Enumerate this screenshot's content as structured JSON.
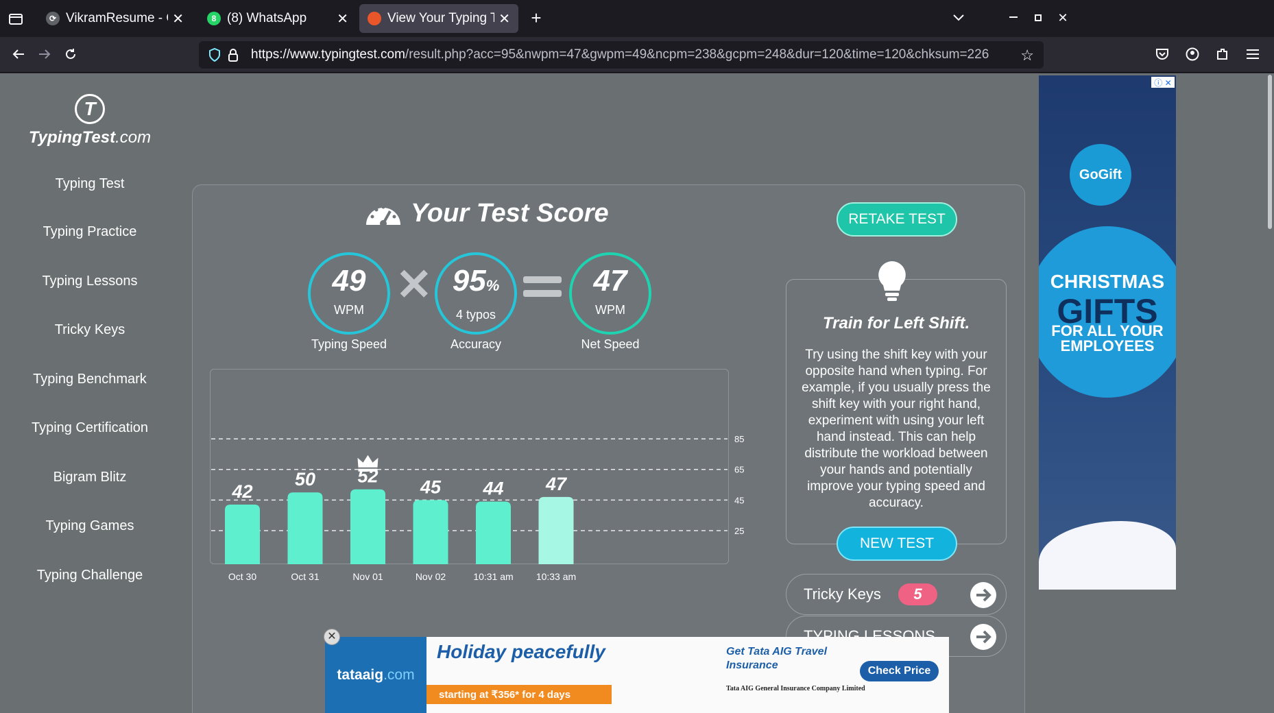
{
  "browser": {
    "tabs": [
      {
        "title": "VikramResume - Online L",
        "favicon_color": "#5f6368",
        "active": false
      },
      {
        "title": "(8) WhatsApp",
        "favicon_color": "#25d366",
        "favicon_text": "8",
        "active": false
      },
      {
        "title": "View Your Typing Test Re",
        "favicon_color": "#e8562a",
        "active": true
      }
    ],
    "url_host": "https://www.typingtest.com",
    "url_rest": "/result.php?acc=95&nwpm=47&gwpm=49&ncpm=238&gcpm=248&dur=120&time=120&chksum=226"
  },
  "sidebar": {
    "logo_brand": "TypingTest",
    "logo_suffix": ".com",
    "logo_mark": "T",
    "items": [
      "Typing Test",
      "Typing Practice",
      "Typing Lessons",
      "Tricky Keys",
      "Typing Benchmark",
      "Typing Certification",
      "Bigram Blitz",
      "Typing Games",
      "Typing Challenge"
    ]
  },
  "score": {
    "title": "Your Test Score",
    "typing_speed": {
      "value": "49",
      "unit": "WPM",
      "caption": "Typing Speed"
    },
    "accuracy": {
      "value": "95",
      "unit_symbol": "%",
      "sub": "4 typos",
      "caption": "Accuracy"
    },
    "net_speed": {
      "value": "47",
      "unit": "WPM",
      "caption": "Net Speed"
    },
    "retake_label": "RETAKE TEST"
  },
  "chart_data": {
    "type": "bar",
    "categories": [
      "Oct 30",
      "Oct 31",
      "Nov 01",
      "Nov 02",
      "10:31 am",
      "10:33 am"
    ],
    "values": [
      42,
      50,
      52,
      45,
      44,
      47
    ],
    "best_index": 2,
    "current_index": 5,
    "y_ticks": [
      85,
      65,
      45,
      25
    ],
    "ylim": [
      0,
      100
    ],
    "bar_color": "#5eefcf",
    "current_bar_color": "#a6f7e3"
  },
  "tip": {
    "title": "Train for Left Shift.",
    "body": "Try using the shift key with your opposite hand when typing. For example, if you usually press the shift key with your right hand, experiment with using your left hand instead. This can help distribute the workload between your hands and potentially improve your typing speed and accuracy.",
    "new_test_label": "NEW TEST"
  },
  "pills": [
    {
      "label": "Tricky Keys",
      "badge": "5"
    },
    {
      "label": "TYPING LESSONS",
      "badge": ""
    }
  ],
  "ads": {
    "side": {
      "logo": "GoGift",
      "line1": "CHRISTMAS",
      "line2": "GIFTS",
      "line3": "FOR ALL YOUR EMPLOYEES"
    },
    "bottom": {
      "brand": "tataaig",
      "brand_suffix": ".com",
      "headline": "Holiday peacefully",
      "offer": "starting at ₹356* for 4 days",
      "cta_title": "Get Tata AIG Travel Insurance",
      "cta_button": "Check Price",
      "company": "Tata AIG General Insurance Company Limited"
    }
  }
}
